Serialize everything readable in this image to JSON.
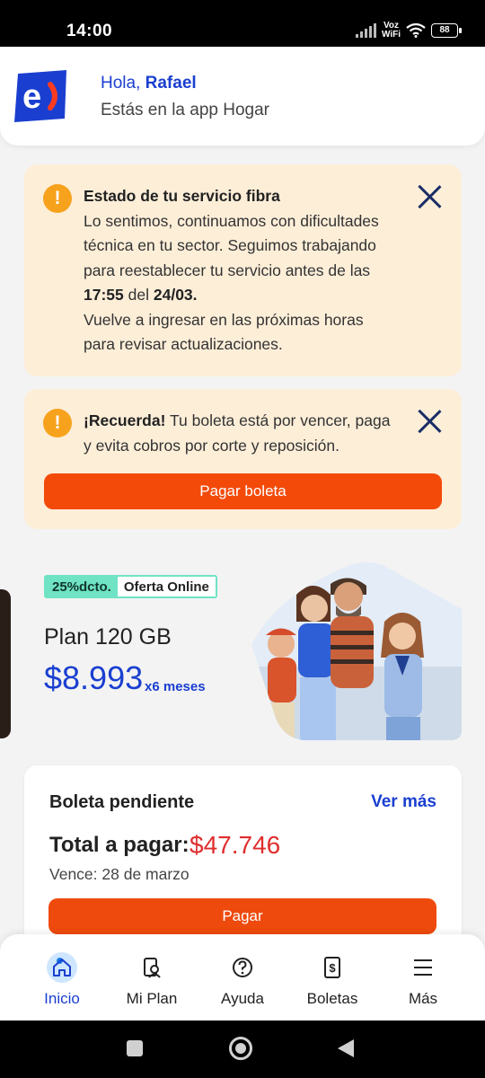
{
  "status_bar": {
    "time": "14:00",
    "network_label_top": "Voz",
    "network_label_bottom": "WiFi",
    "battery": "88"
  },
  "header": {
    "greeting": "Hola,",
    "user_name": "Rafael",
    "subtitle": "Estás en la app Hogar",
    "logo_icon": "entel-logo"
  },
  "alert_service": {
    "icon": "warning-icon",
    "title": "Estado de tu servicio fibra",
    "line1": "Lo sentimos, continuamos con dificultades",
    "line2": "técnica en tu sector. Seguimos trabajando",
    "line3": "para reestablecer tu servicio antes de las",
    "time": "17:55",
    "del": "del",
    "date": "24/03.",
    "line5": "Vuelve a ingresar en las próximas horas",
    "line6": "para revisar actualizaciones."
  },
  "alert_reminder": {
    "icon": "warning-icon",
    "title": "¡Recuerda!",
    "text_part1": "Tu boleta está por vencer, paga",
    "text_part2": "y evita cobros por corte y reposición.",
    "button": "Pagar boleta"
  },
  "promo": {
    "discount_badge": "25%dcto.",
    "online_badge": "Oferta Online",
    "plan_name": "Plan 120 GB",
    "price": "$8.993",
    "duration": "x6 meses"
  },
  "boleta": {
    "title": "Boleta pendiente",
    "ver_mas": "Ver más",
    "total_label": "Total a pagar:",
    "total_value": "$47.746",
    "due": "Vence: 28 de marzo",
    "pay_button": "Pagar"
  },
  "bottom_nav": [
    {
      "label": "Inicio",
      "icon": "home-icon",
      "active": true
    },
    {
      "label": "Mi Plan",
      "icon": "plan-icon",
      "active": false
    },
    {
      "label": "Ayuda",
      "icon": "help-icon",
      "active": false
    },
    {
      "label": "Boletas",
      "icon": "bill-icon",
      "active": false
    },
    {
      "label": "Más",
      "icon": "menu-icon",
      "active": false
    }
  ],
  "colors": {
    "brand_blue": "#1a3fd0",
    "accent_orange": "#f34a0a",
    "alert_bg": "#fdeed8",
    "warning": "#f7a21c",
    "amount_red": "#e02d2d",
    "badge_green": "#6fe3c4"
  }
}
